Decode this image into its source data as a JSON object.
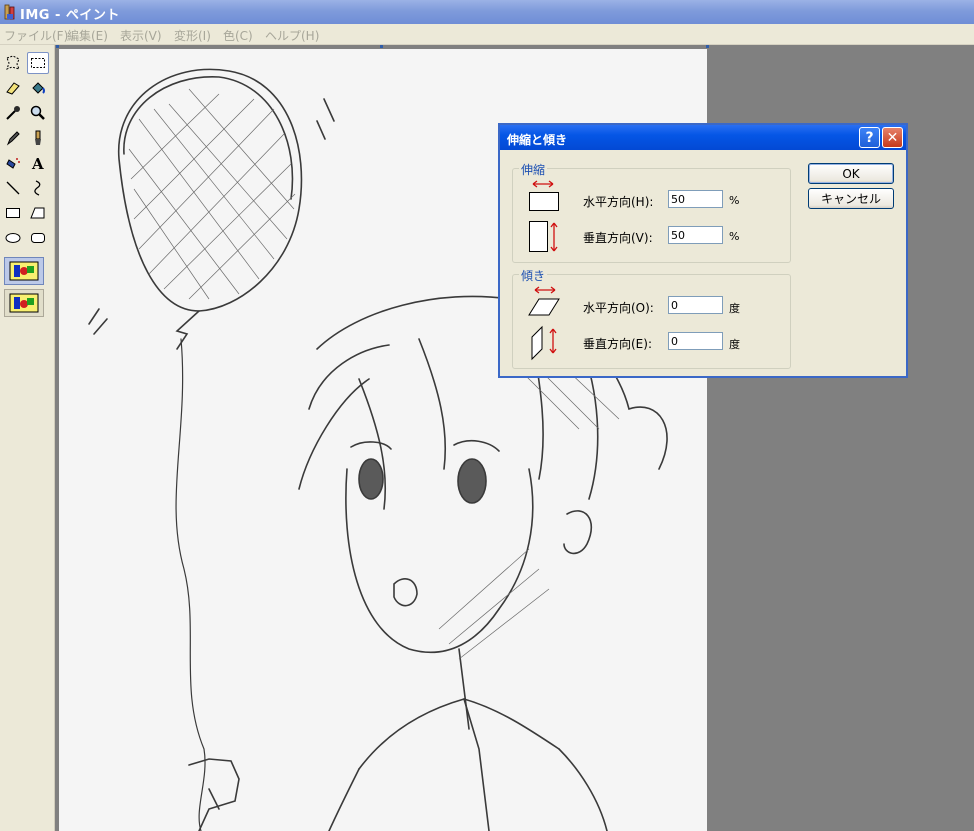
{
  "window": {
    "title": "IMG - ペイント",
    "app_icon": "paint-icon"
  },
  "menu": [
    "ファイル(F)",
    "編集(E)",
    "表示(V)",
    "変形(I)",
    "色(C)",
    "ヘルプ(H)"
  ],
  "toolbox": {
    "tools": [
      "free-form-select-icon",
      "rect-select-icon",
      "eraser-icon",
      "fill-bucket-icon",
      "color-picker-icon",
      "magnifier-icon",
      "pencil-icon",
      "brush-icon",
      "airbrush-icon",
      "text-icon",
      "line-icon",
      "curve-icon",
      "rectangle-icon",
      "polygon-icon",
      "ellipse-icon",
      "rounded-rect-icon"
    ],
    "selected_tool": "rect-select-icon",
    "options": [
      "opaque-selection-icon",
      "transparent-selection-icon"
    ],
    "selected_option": "opaque-selection-icon"
  },
  "dialog": {
    "title": "伸縮と傾き",
    "help_label": "?",
    "close_label": "✕",
    "stretch": {
      "legend": "伸縮",
      "horizontal_label": "水平方向(H):",
      "horizontal_value": "50",
      "horizontal_unit": "%",
      "vertical_label": "垂直方向(V):",
      "vertical_value": "50",
      "vertical_unit": "%"
    },
    "skew": {
      "legend": "傾き",
      "horizontal_label": "水平方向(O):",
      "horizontal_value": "0",
      "horizontal_unit": "度",
      "vertical_label": "垂直方向(E):",
      "vertical_value": "0",
      "vertical_unit": "度"
    },
    "ok_label": "OK",
    "cancel_label": "キャンセル",
    "colors": {
      "title": "#0556e6",
      "arrows": "#d01010",
      "legend": "#1b4fb2"
    }
  }
}
